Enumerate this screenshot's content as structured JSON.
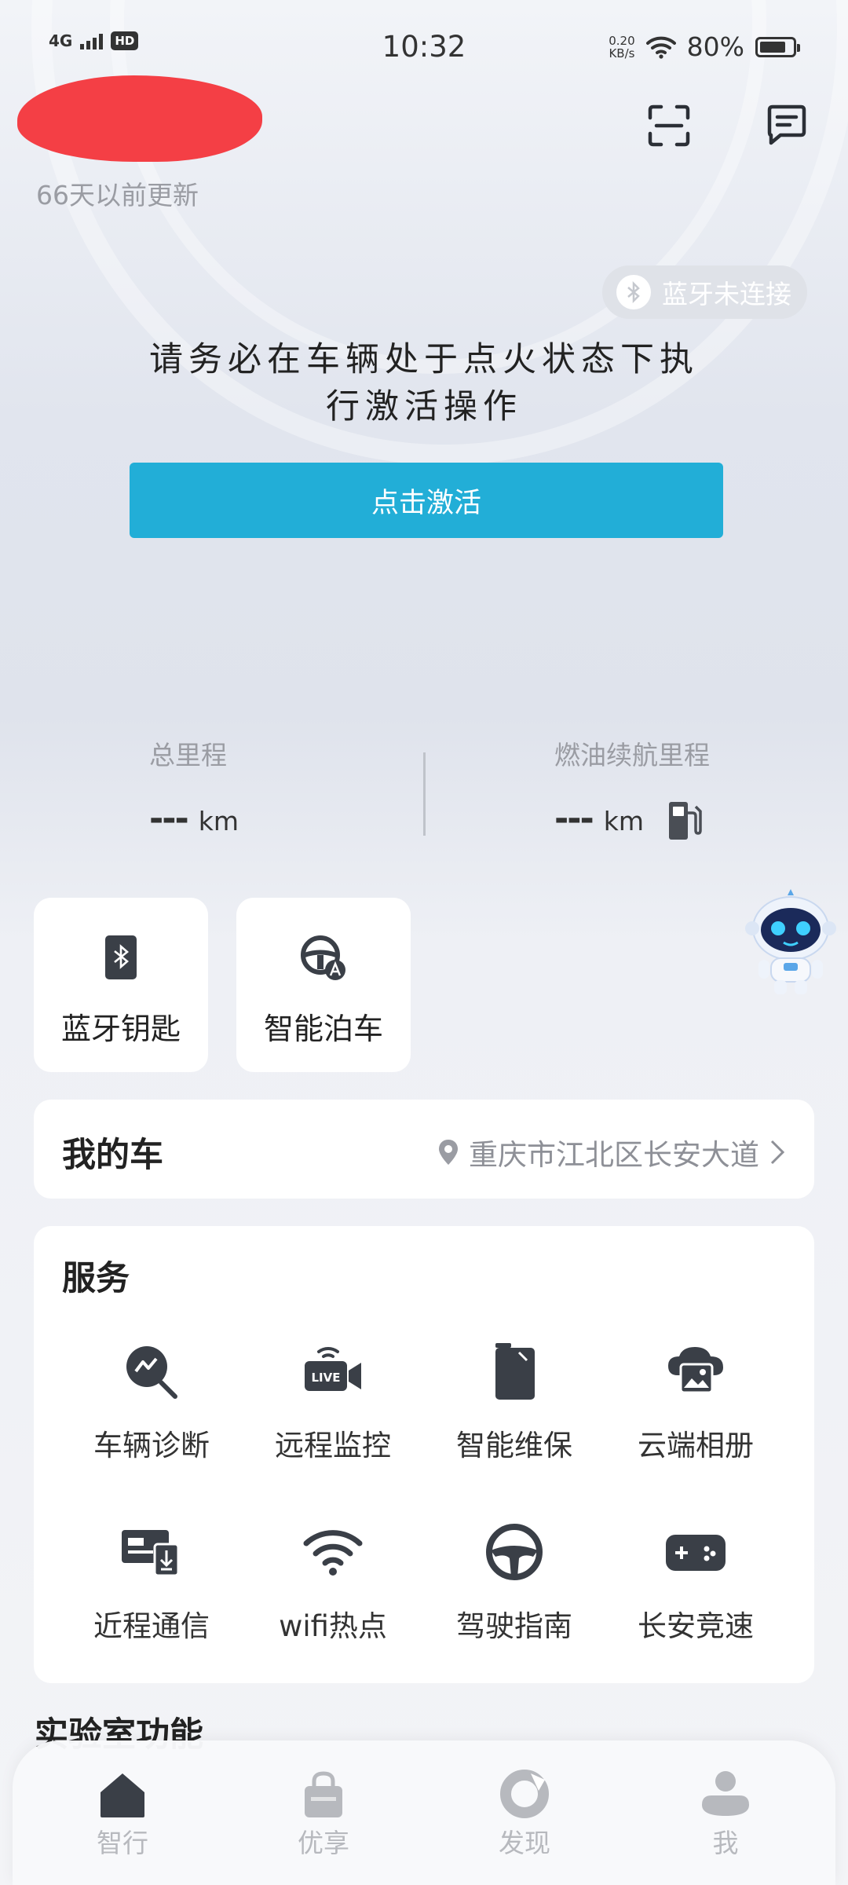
{
  "status_bar": {
    "network": "4G",
    "hd": "HD",
    "time": "10:32",
    "speed_value": "0.20",
    "speed_unit": "KB/s",
    "battery": "80%",
    "battery_level": 0.8
  },
  "header": {
    "vehicle_name": "",
    "update_time": "66天以前更新",
    "scan_icon": "scan-icon",
    "message_icon": "message-icon"
  },
  "bluetooth_status": "蓝牙未连接",
  "activation": {
    "message_line1": "请务必在车辆处于点火状态下执",
    "message_line2": "行激活操作",
    "button_label": "点击激活"
  },
  "mileage": {
    "total_label": "总里程",
    "total_value": "---",
    "total_unit": "km",
    "range_label": "燃油续航里程",
    "range_value": "---",
    "range_unit": "km"
  },
  "quick_actions": [
    {
      "label": "蓝牙钥匙",
      "icon": "bluetooth-key-icon"
    },
    {
      "label": "智能泊车",
      "icon": "steering-wheel-auto-icon"
    }
  ],
  "my_car": {
    "title": "我的车",
    "location": "重庆市江北区长安大道"
  },
  "services": {
    "title": "服务",
    "items": [
      {
        "label": "车辆诊断",
        "icon": "diagnosis-icon"
      },
      {
        "label": "远程监控",
        "icon": "live-camera-icon"
      },
      {
        "label": "智能维保",
        "icon": "maintenance-icon"
      },
      {
        "label": "云端相册",
        "icon": "cloud-album-icon"
      },
      {
        "label": "近程通信",
        "icon": "short-range-comm-icon"
      },
      {
        "label": "wifi热点",
        "icon": "wifi-icon"
      },
      {
        "label": "驾驶指南",
        "icon": "steering-wheel-icon"
      },
      {
        "label": "长安竞速",
        "icon": "gamepad-icon"
      }
    ]
  },
  "lab_title": "实验室功能",
  "bottom_nav": [
    {
      "label": "智行",
      "icon": "home-icon"
    },
    {
      "label": "优享",
      "icon": "shopping-bag-icon"
    },
    {
      "label": "发现",
      "icon": "discover-icon"
    },
    {
      "label": "我",
      "icon": "profile-icon"
    }
  ]
}
